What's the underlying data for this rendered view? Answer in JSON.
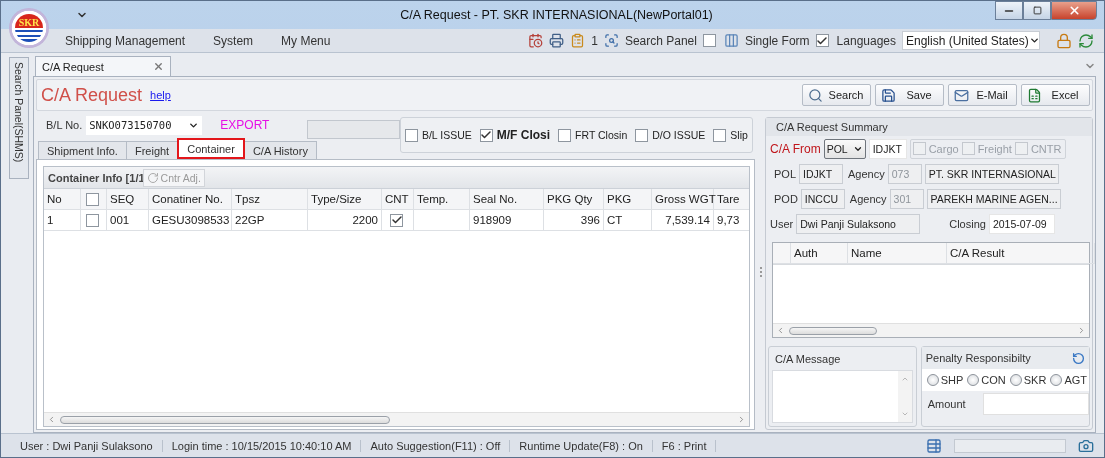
{
  "window": {
    "title": "C/A Request - PT. SKR INTERNASIONAL(NewPortal01)"
  },
  "logo": {
    "text": "SKR"
  },
  "menu": [
    "Shipping Management",
    "System",
    "My Menu"
  ],
  "toolbar": {
    "count": "1",
    "search_panel": {
      "label": "Search Panel",
      "checked": false
    },
    "single_form": {
      "label": "Single Form",
      "checked": true
    },
    "languages": {
      "label": "Languages",
      "value": "English (United States)"
    }
  },
  "side_panel": {
    "label": "Search Panel(SHMS)"
  },
  "doc_tabs": [
    {
      "label": "C/A Request",
      "selected": true
    }
  ],
  "page": {
    "title": "C/A Request",
    "help": "help"
  },
  "actions": [
    {
      "label": "Search",
      "kind": "search"
    },
    {
      "label": "Save",
      "kind": "save"
    },
    {
      "label": "E-Mail",
      "kind": "mail"
    },
    {
      "label": "Excel",
      "kind": "excel"
    }
  ],
  "bl": {
    "label": "B/L No.",
    "value": "SNKO073150700",
    "direction": "EXPORT"
  },
  "flags": [
    {
      "label": "B/L ISSUE",
      "checked": false,
      "bold": false
    },
    {
      "label": "M/F Closi",
      "checked": true,
      "bold": true
    },
    {
      "label": "FRT Closin",
      "checked": false,
      "bold": false
    },
    {
      "label": "D/O ISSUE",
      "checked": false,
      "bold": false
    },
    {
      "label": "Slip",
      "checked": false,
      "bold": false
    }
  ],
  "tabs": [
    {
      "label": "Shipment Info.",
      "selected": false,
      "highlighted": false
    },
    {
      "label": "Freight",
      "selected": false,
      "highlighted": false
    },
    {
      "label": "Container",
      "selected": true,
      "highlighted": true
    },
    {
      "label": "C/A History",
      "selected": false,
      "highlighted": false
    }
  ],
  "container_info": {
    "title": "Container Info [1/1",
    "adjust_button": "Cntr Adj.",
    "columns": [
      {
        "label": "No",
        "kind": "text"
      },
      {
        "kind": "check",
        "checked": false
      },
      {
        "label": "SEQ",
        "kind": "text"
      },
      {
        "label": "Conatiner No.",
        "kind": "text"
      },
      {
        "label": "Tpsz",
        "kind": "text"
      },
      {
        "label": "Type/Size",
        "kind": "number"
      },
      {
        "label": "CNT",
        "kind": "check"
      },
      {
        "label": "Temp.",
        "kind": "text"
      },
      {
        "label": "Seal No.",
        "kind": "text"
      },
      {
        "label": "PKG Qty",
        "kind": "number"
      },
      {
        "label": "PKG",
        "kind": "text"
      },
      {
        "label": "Gross WGT",
        "kind": "number"
      },
      {
        "label": "Tare",
        "kind": "text"
      }
    ],
    "rows": [
      {
        "cells": [
          "1",
          false,
          "001",
          "GESU3098533",
          "22GP",
          "2200",
          true,
          null,
          "918909",
          "396",
          "CT",
          "7,539.14",
          "9,73"
        ]
      }
    ]
  },
  "summary": {
    "title": "C/A Request Summary",
    "from_label": "C/A From",
    "from_value": "POL",
    "from_port": "IDJKT",
    "options": [
      {
        "label": "Cargo",
        "checked": false
      },
      {
        "label": "Freight",
        "checked": false
      },
      {
        "label": "CNTR",
        "checked": false
      }
    ],
    "ports": [
      {
        "label": "POL",
        "code": "IDJKT",
        "agency_label": "Agency",
        "agency_code": "073",
        "agency_name": "PT. SKR INTERNASIONAL"
      },
      {
        "label": "POD",
        "code": "INCCU",
        "agency_label": "Agency",
        "agency_code": "301",
        "agency_name": "PAREKH MARINE AGEN..."
      }
    ],
    "user_label": "User",
    "user": "Dwi Panji Sulaksono",
    "closing_label": "Closing",
    "closing": "2015-07-09"
  },
  "result_grid": {
    "columns": [
      "Auth",
      "Name",
      "C/A Result"
    ]
  },
  "message": {
    "title": "C/A Message"
  },
  "penalty": {
    "title": "Penalty Responsibilty",
    "options": [
      {
        "label": "SHP",
        "selected": false
      },
      {
        "label": "CON",
        "selected": false
      },
      {
        "label": "SKR",
        "selected": false
      },
      {
        "label": "AGT",
        "selected": false
      }
    ],
    "amount_label": "Amount"
  },
  "status_bar": [
    "User : Dwi Panji Sulaksono",
    "Login time : 10/15/2015 10:40:10 AM",
    "Auto Suggestion(F11) : Off",
    "Runtime Update(F8) : On",
    "F6 : Print"
  ]
}
